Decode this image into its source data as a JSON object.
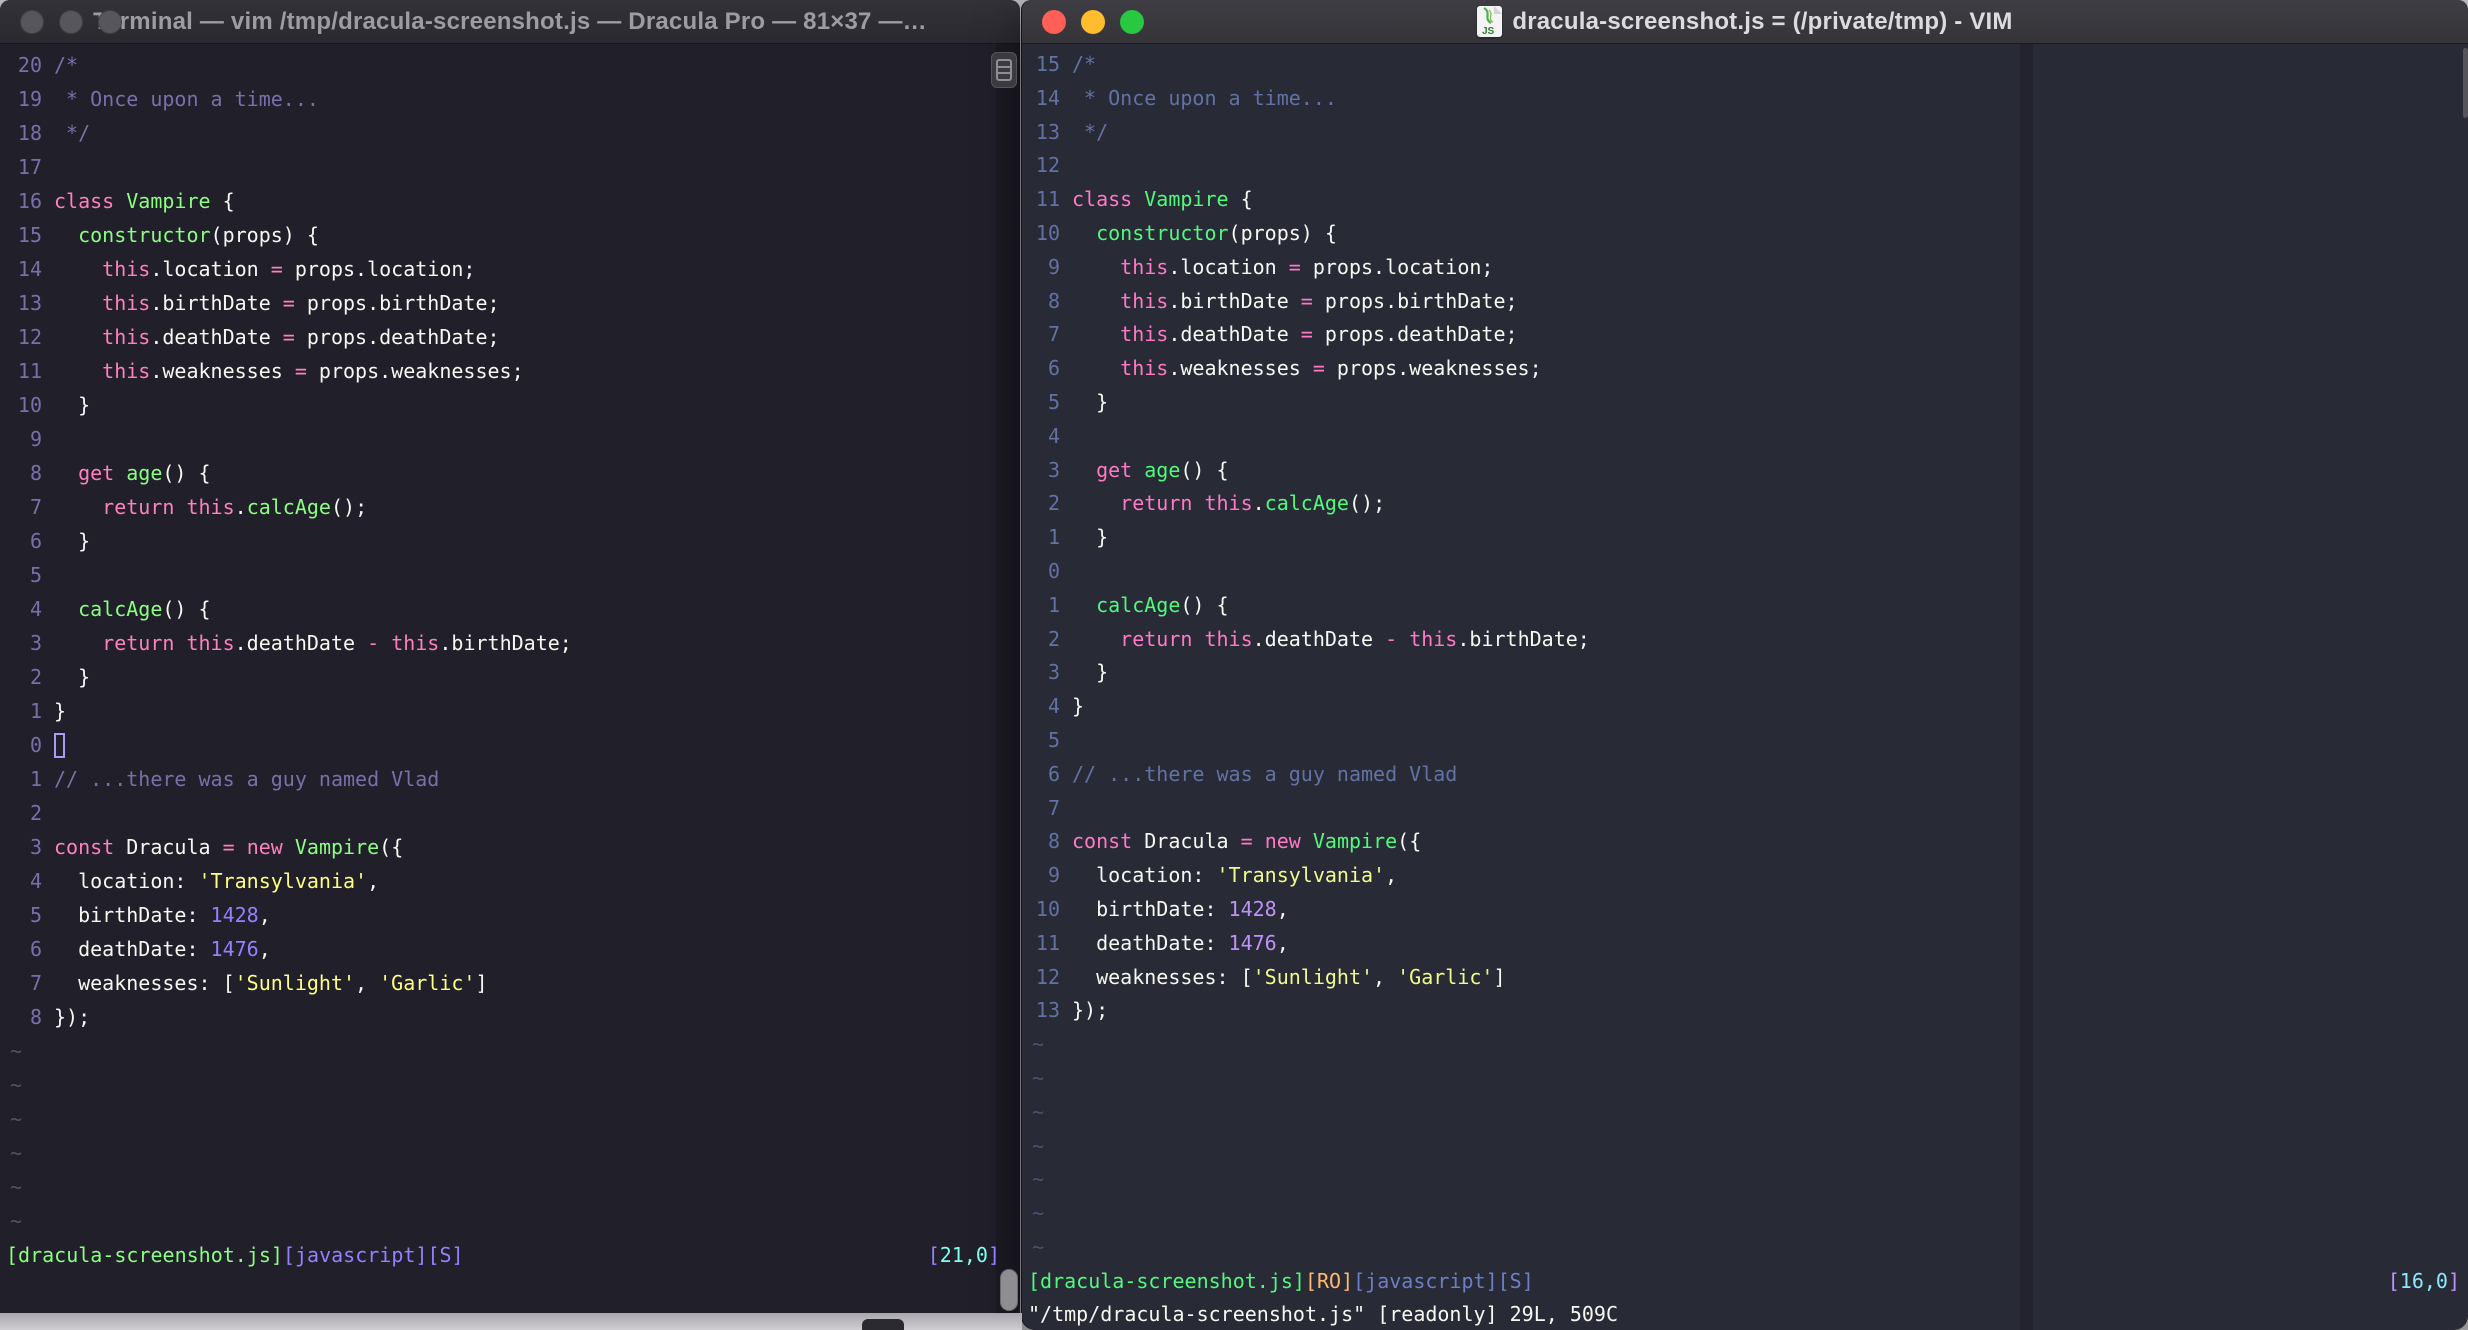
{
  "left_window": {
    "title": "Terminal — vim /tmp/dracula-screenshot.js — Dracula Pro — 81×37 —…",
    "theme_name": "Dracula Pro",
    "palette": {
      "bg": "#201F2A",
      "fg": "#F8F8F2",
      "pink": "#FF80BF",
      "green": "#8AFF80",
      "yellow": "#FFFF80",
      "purple": "#9580FF",
      "comment": "#7970A9",
      "linenr": "#7970A9",
      "cyan": "#80FFEA",
      "tilde": "#555166",
      "cursor": "#A99CF2"
    },
    "lines": [
      {
        "n": "20",
        "s": [
          [
            "/*",
            "comment"
          ]
        ]
      },
      {
        "n": "19",
        "s": [
          [
            " * Once upon a time...",
            "comment"
          ]
        ]
      },
      {
        "n": "18",
        "s": [
          [
            " */",
            "comment"
          ]
        ]
      },
      {
        "n": "17",
        "s": []
      },
      {
        "n": "16",
        "s": [
          [
            "class",
            "pink"
          ],
          [
            " ",
            "fg"
          ],
          [
            "Vampire",
            "green"
          ],
          [
            " {",
            "fg"
          ]
        ]
      },
      {
        "n": "15",
        "s": [
          [
            "  ",
            "fg"
          ],
          [
            "constructor",
            "green"
          ],
          [
            "(props) {",
            "fg"
          ]
        ]
      },
      {
        "n": "14",
        "s": [
          [
            "    ",
            "fg"
          ],
          [
            "this",
            "pink"
          ],
          [
            ".location ",
            "fg"
          ],
          [
            "=",
            "pink"
          ],
          [
            " props.location;",
            "fg"
          ]
        ]
      },
      {
        "n": "13",
        "s": [
          [
            "    ",
            "fg"
          ],
          [
            "this",
            "pink"
          ],
          [
            ".birthDate ",
            "fg"
          ],
          [
            "=",
            "pink"
          ],
          [
            " props.birthDate;",
            "fg"
          ]
        ]
      },
      {
        "n": "12",
        "s": [
          [
            "    ",
            "fg"
          ],
          [
            "this",
            "pink"
          ],
          [
            ".deathDate ",
            "fg"
          ],
          [
            "=",
            "pink"
          ],
          [
            " props.deathDate;",
            "fg"
          ]
        ]
      },
      {
        "n": "11",
        "s": [
          [
            "    ",
            "fg"
          ],
          [
            "this",
            "pink"
          ],
          [
            ".weaknesses ",
            "fg"
          ],
          [
            "=",
            "pink"
          ],
          [
            " props.weaknesses;",
            "fg"
          ]
        ]
      },
      {
        "n": "10",
        "s": [
          [
            "  }",
            "fg"
          ]
        ]
      },
      {
        "n": "9",
        "s": []
      },
      {
        "n": "8",
        "s": [
          [
            "  ",
            "fg"
          ],
          [
            "get",
            "pink"
          ],
          [
            " ",
            "fg"
          ],
          [
            "age",
            "green"
          ],
          [
            "() {",
            "fg"
          ]
        ]
      },
      {
        "n": "7",
        "s": [
          [
            "    ",
            "fg"
          ],
          [
            "return",
            "pink"
          ],
          [
            " ",
            "fg"
          ],
          [
            "this",
            "pink"
          ],
          [
            ".",
            "fg"
          ],
          [
            "calcAge",
            "green"
          ],
          [
            "();",
            "fg"
          ]
        ]
      },
      {
        "n": "6",
        "s": [
          [
            "  }",
            "fg"
          ]
        ]
      },
      {
        "n": "5",
        "s": []
      },
      {
        "n": "4",
        "s": [
          [
            "  ",
            "fg"
          ],
          [
            "calcAge",
            "green"
          ],
          [
            "() {",
            "fg"
          ]
        ]
      },
      {
        "n": "3",
        "s": [
          [
            "    ",
            "fg"
          ],
          [
            "return",
            "pink"
          ],
          [
            " ",
            "fg"
          ],
          [
            "this",
            "pink"
          ],
          [
            ".deathDate ",
            "fg"
          ],
          [
            "-",
            "pink"
          ],
          [
            " ",
            "fg"
          ],
          [
            "this",
            "pink"
          ],
          [
            ".birthDate;",
            "fg"
          ]
        ]
      },
      {
        "n": "2",
        "s": [
          [
            "  }",
            "fg"
          ]
        ]
      },
      {
        "n": "1",
        "s": [
          [
            "}",
            "fg"
          ]
        ]
      },
      {
        "n": "0",
        "s": [],
        "cursor": "outline"
      },
      {
        "n": "1",
        "s": [
          [
            "// ...there was a guy named Vlad",
            "comment"
          ]
        ]
      },
      {
        "n": "2",
        "s": []
      },
      {
        "n": "3",
        "s": [
          [
            "const",
            "pink"
          ],
          [
            " Dracula ",
            "fg"
          ],
          [
            "=",
            "pink"
          ],
          [
            " ",
            "fg"
          ],
          [
            "new",
            "pink"
          ],
          [
            " ",
            "fg"
          ],
          [
            "Vampire",
            "green"
          ],
          [
            "({",
            "fg"
          ]
        ]
      },
      {
        "n": "4",
        "s": [
          [
            "  location: ",
            "fg"
          ],
          [
            "'Transylvania'",
            "yellow"
          ],
          [
            ",",
            "fg"
          ]
        ]
      },
      {
        "n": "5",
        "s": [
          [
            "  birthDate: ",
            "fg"
          ],
          [
            "1428",
            "purple"
          ],
          [
            ",",
            "fg"
          ]
        ]
      },
      {
        "n": "6",
        "s": [
          [
            "  deathDate: ",
            "fg"
          ],
          [
            "1476",
            "purple"
          ],
          [
            ",",
            "fg"
          ]
        ]
      },
      {
        "n": "7",
        "s": [
          [
            "  weaknesses: [",
            "fg"
          ],
          [
            "'Sunlight'",
            "yellow"
          ],
          [
            ", ",
            "fg"
          ],
          [
            "'Garlic'",
            "yellow"
          ],
          [
            "]",
            "fg"
          ]
        ]
      },
      {
        "n": "8",
        "s": [
          [
            "});",
            "fg"
          ]
        ]
      }
    ],
    "tildes": 6,
    "status_left": [
      [
        "[dracula-screenshot.js]",
        "green"
      ],
      [
        "[javascript]",
        "purple"
      ],
      [
        "[S]",
        "purple"
      ]
    ],
    "status_right": [
      [
        "[",
        "purple"
      ],
      [
        "21,0",
        "cyan"
      ],
      [
        "]",
        "purple"
      ]
    ]
  },
  "right_window": {
    "title": "dracula-screenshot.js = (/private/tmp) - VIM",
    "icon_label": "JS",
    "traffic_lights": [
      "#FF5F57",
      "#FEBC2E",
      "#28C840"
    ],
    "palette": {
      "bg": "#282A36",
      "fg": "#F8F8F2",
      "pink": "#FF79C6",
      "green": "#50FA7B",
      "yellow": "#F1FA8C",
      "purple": "#BD93F9",
      "comment": "#6272A4",
      "linenr": "#6272A4",
      "cyan": "#8BE9FD",
      "orange": "#FFB86C",
      "blue": "#6D7FC4",
      "tilde": "#4A5272",
      "colorcolumn": "#22232E"
    },
    "lines": [
      {
        "n": "15",
        "s": [
          [
            "/*",
            "comment"
          ]
        ]
      },
      {
        "n": "14",
        "s": [
          [
            " * Once upon a time...",
            "comment"
          ]
        ]
      },
      {
        "n": "13",
        "s": [
          [
            " */",
            "comment"
          ]
        ]
      },
      {
        "n": "12",
        "s": []
      },
      {
        "n": "11",
        "s": [
          [
            "class",
            "pink"
          ],
          [
            " ",
            "fg"
          ],
          [
            "Vampire",
            "green"
          ],
          [
            " {",
            "fg"
          ]
        ]
      },
      {
        "n": "10",
        "s": [
          [
            "  ",
            "fg"
          ],
          [
            "constructor",
            "green"
          ],
          [
            "(props) {",
            "fg"
          ]
        ]
      },
      {
        "n": "9",
        "s": [
          [
            "    ",
            "fg"
          ],
          [
            "this",
            "pink"
          ],
          [
            ".location ",
            "fg"
          ],
          [
            "=",
            "pink"
          ],
          [
            " props.location;",
            "fg"
          ]
        ]
      },
      {
        "n": "8",
        "s": [
          [
            "    ",
            "fg"
          ],
          [
            "this",
            "pink"
          ],
          [
            ".birthDate ",
            "fg"
          ],
          [
            "=",
            "pink"
          ],
          [
            " props.birthDate;",
            "fg"
          ]
        ]
      },
      {
        "n": "7",
        "s": [
          [
            "    ",
            "fg"
          ],
          [
            "this",
            "pink"
          ],
          [
            ".deathDate ",
            "fg"
          ],
          [
            "=",
            "pink"
          ],
          [
            " props.deathDate;",
            "fg"
          ]
        ]
      },
      {
        "n": "6",
        "s": [
          [
            "    ",
            "fg"
          ],
          [
            "this",
            "pink"
          ],
          [
            ".weaknesses ",
            "fg"
          ],
          [
            "=",
            "pink"
          ],
          [
            " props.weaknesses;",
            "fg"
          ]
        ]
      },
      {
        "n": "5",
        "s": [
          [
            "  }",
            "fg"
          ]
        ]
      },
      {
        "n": "4",
        "s": []
      },
      {
        "n": "3",
        "s": [
          [
            "  ",
            "fg"
          ],
          [
            "get",
            "pink"
          ],
          [
            " ",
            "fg"
          ],
          [
            "age",
            "green"
          ],
          [
            "() {",
            "fg"
          ]
        ]
      },
      {
        "n": "2",
        "s": [
          [
            "    ",
            "fg"
          ],
          [
            "return",
            "pink"
          ],
          [
            " ",
            "fg"
          ],
          [
            "this",
            "pink"
          ],
          [
            ".",
            "fg"
          ],
          [
            "calcAge",
            "green"
          ],
          [
            "();",
            "fg"
          ]
        ]
      },
      {
        "n": "1",
        "s": [
          [
            "  }",
            "fg"
          ]
        ]
      },
      {
        "n": "0",
        "s": []
      },
      {
        "n": "1",
        "s": [
          [
            "  ",
            "fg"
          ],
          [
            "calcAge",
            "green"
          ],
          [
            "() {",
            "fg"
          ]
        ]
      },
      {
        "n": "2",
        "s": [
          [
            "    ",
            "fg"
          ],
          [
            "return",
            "pink"
          ],
          [
            " ",
            "fg"
          ],
          [
            "this",
            "pink"
          ],
          [
            ".deathDate ",
            "fg"
          ],
          [
            "-",
            "pink"
          ],
          [
            " ",
            "fg"
          ],
          [
            "this",
            "pink"
          ],
          [
            ".birthDate;",
            "fg"
          ]
        ]
      },
      {
        "n": "3",
        "s": [
          [
            "  }",
            "fg"
          ]
        ]
      },
      {
        "n": "4",
        "s": [
          [
            "}",
            "fg"
          ]
        ]
      },
      {
        "n": "5",
        "s": []
      },
      {
        "n": "6",
        "s": [
          [
            "// ...there was a guy named Vlad",
            "comment"
          ]
        ]
      },
      {
        "n": "7",
        "s": []
      },
      {
        "n": "8",
        "s": [
          [
            "const",
            "pink"
          ],
          [
            " Dracula ",
            "fg"
          ],
          [
            "=",
            "pink"
          ],
          [
            " ",
            "fg"
          ],
          [
            "new",
            "pink"
          ],
          [
            " ",
            "fg"
          ],
          [
            "Vampire",
            "green"
          ],
          [
            "({",
            "fg"
          ]
        ]
      },
      {
        "n": "9",
        "s": [
          [
            "  location: ",
            "fg"
          ],
          [
            "'Transylvania'",
            "yellow"
          ],
          [
            ",",
            "fg"
          ]
        ]
      },
      {
        "n": "10",
        "s": [
          [
            "  birthDate: ",
            "fg"
          ],
          [
            "1428",
            "purple"
          ],
          [
            ",",
            "fg"
          ]
        ]
      },
      {
        "n": "11",
        "s": [
          [
            "  deathDate: ",
            "fg"
          ],
          [
            "1476",
            "purple"
          ],
          [
            ",",
            "fg"
          ]
        ]
      },
      {
        "n": "12",
        "s": [
          [
            "  weaknesses: [",
            "fg"
          ],
          [
            "'Sunlight'",
            "yellow"
          ],
          [
            ", ",
            "fg"
          ],
          [
            "'Garlic'",
            "yellow"
          ],
          [
            "]",
            "fg"
          ]
        ]
      },
      {
        "n": "13",
        "s": [
          [
            "});",
            "fg"
          ]
        ]
      }
    ],
    "tildes": 7,
    "status_left": [
      [
        "[dracula-screenshot.js]",
        "green"
      ],
      [
        "[RO]",
        "orange"
      ],
      [
        "[javascript]",
        "blue"
      ],
      [
        "[S]",
        "blue"
      ]
    ],
    "status_right": [
      [
        "[",
        "purple"
      ],
      [
        "16,0",
        "cyan"
      ],
      [
        "]",
        "purple"
      ]
    ],
    "message": "\"/tmp/dracula-screenshot.js\" [readonly] 29L, 509C"
  }
}
